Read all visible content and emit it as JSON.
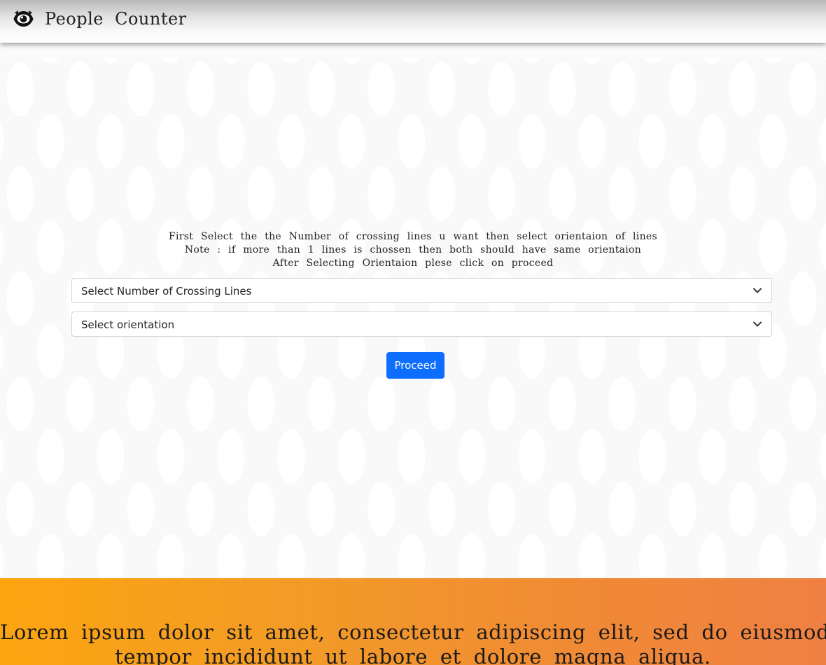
{
  "header": {
    "icon": "eye-logo-icon",
    "title": "People Counter"
  },
  "instructions": {
    "line1": "First Select the the Number of crossing lines u want then select orientaion of lines",
    "line2": "Note : if more than 1 lines is chossen then both should have same orientaion",
    "line3": "After Selecting Orientaion plese click on proceed"
  },
  "form": {
    "lines_select": {
      "value": "Select Number of Crossing Lines",
      "icon": "chevron-down-icon"
    },
    "orientation_select": {
      "value": "Select orientation",
      "icon": "chevron-down-icon"
    },
    "proceed_label": "Proceed"
  },
  "footer": {
    "line1": "Lorem ipsum dolor sit amet, consectetur adipiscing elit, sed do eiusmod",
    "line2": "tempor incididunt ut labore et dolore magna aliqua."
  },
  "colors": {
    "primary": "#0d6efd",
    "footer_gradient_start": "#fda50f",
    "footer_gradient_end": "#ef8043"
  }
}
